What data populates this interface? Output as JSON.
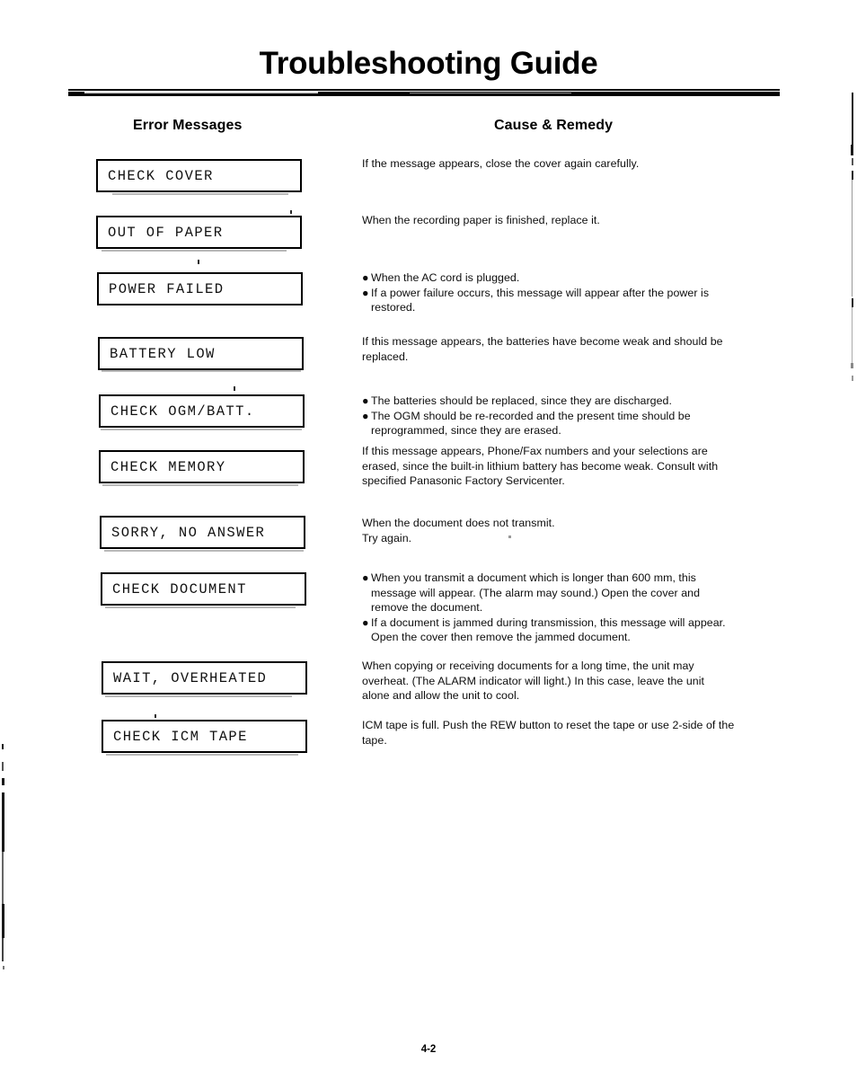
{
  "document": {
    "title": "Troubleshooting Guide",
    "page_number": "4-2"
  },
  "columns": {
    "left_heading": "Error Messages",
    "right_heading": "Cause & Remedy"
  },
  "rows": [
    {
      "message": "CHECK COVER",
      "remedy_lines": [
        {
          "type": "plain",
          "text": "If the message appears, close the cover again carefully."
        }
      ]
    },
    {
      "message": "OUT OF PAPER",
      "remedy_lines": [
        {
          "type": "plain",
          "text": "When the recording paper is finished, replace it."
        }
      ]
    },
    {
      "message": "POWER FAILED",
      "remedy_lines": [
        {
          "type": "bullet",
          "text": "When the AC cord is plugged."
        },
        {
          "type": "bullet",
          "text": "If a power failure occurs, this message will appear after the power is"
        },
        {
          "type": "cont",
          "text": "restored."
        }
      ]
    },
    {
      "message": "BATTERY LOW",
      "remedy_lines": [
        {
          "type": "plain",
          "text": "If this message appears, the batteries have become weak and should be"
        },
        {
          "type": "plain",
          "text": "replaced."
        }
      ]
    },
    {
      "message": "CHECK OGM/BATT.",
      "remedy_lines": [
        {
          "type": "bullet",
          "text": "The batteries should be replaced, since they are discharged."
        },
        {
          "type": "bullet",
          "text": "The OGM should be re-recorded and the present time should be"
        },
        {
          "type": "cont",
          "text": "reprogrammed, since they are erased."
        }
      ]
    },
    {
      "message": "CHECK MEMORY",
      "remedy_lines": [
        {
          "type": "plain",
          "text": "If this message appears, Phone/Fax numbers and your selections are"
        },
        {
          "type": "plain",
          "text": "erased, since the built-in lithium battery has become weak. Consult with"
        },
        {
          "type": "plain",
          "text": "specified Panasonic Factory Servicenter."
        }
      ]
    },
    {
      "message": "SORRY, NO ANSWER",
      "remedy_lines": [
        {
          "type": "plain",
          "text": "When the document does not transmit."
        },
        {
          "type": "plain",
          "text": "Try again."
        }
      ]
    },
    {
      "message": "CHECK DOCUMENT",
      "remedy_lines": [
        {
          "type": "bullet",
          "text": "When you transmit a document which is longer than 600 mm, this"
        },
        {
          "type": "cont",
          "text": "message will appear. (The alarm may sound.) Open the cover and"
        },
        {
          "type": "cont",
          "text": "remove the document."
        },
        {
          "type": "bullet",
          "text": "If a document is jammed during transmission, this message will appear."
        },
        {
          "type": "cont",
          "text": "Open the cover then remove the jammed document."
        }
      ]
    },
    {
      "message": "WAIT, OVERHEATED",
      "remedy_lines": [
        {
          "type": "plain",
          "text": "When copying or receiving documents for a long time, the unit may"
        },
        {
          "type": "plain",
          "text": "overheat. (The ALARM indicator will light.) In this case, leave the unit"
        },
        {
          "type": "plain",
          "text": "alone and allow the unit to cool."
        }
      ]
    },
    {
      "message": "CHECK ICM TAPE",
      "remedy_lines": [
        {
          "type": "plain",
          "text": "ICM tape is full. Push the REW button to reset the tape or use 2-side of the"
        },
        {
          "type": "plain",
          "text": "tape."
        }
      ]
    }
  ],
  "bullet_glyph": "●"
}
